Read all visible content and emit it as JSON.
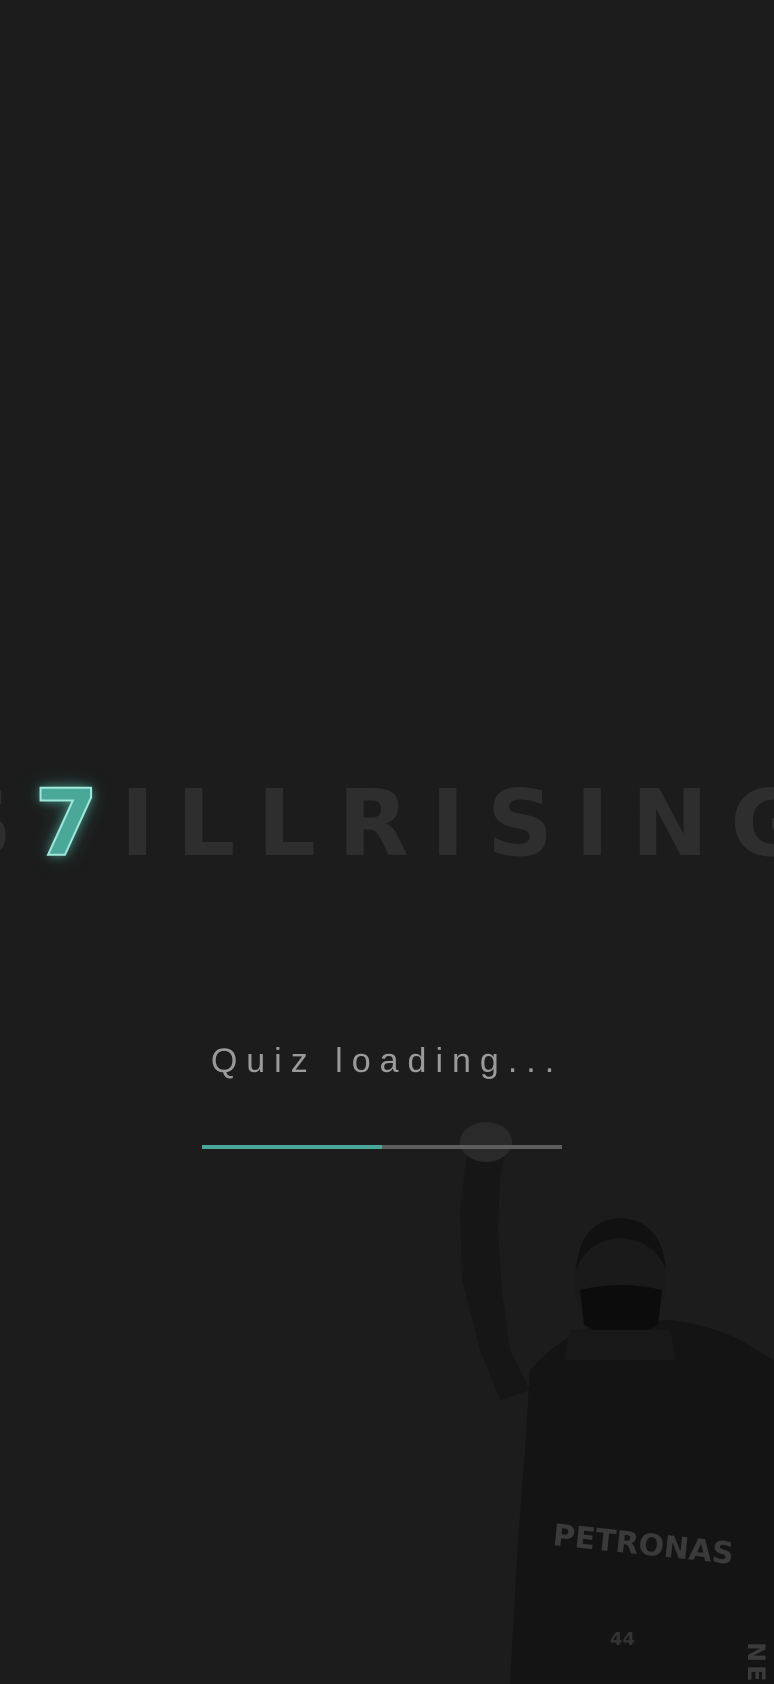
{
  "logo": {
    "prefix": "S",
    "digit": "7",
    "suffix": "ILLRISING",
    "accent_color": "#4aa898"
  },
  "loading": {
    "text": "Quiz loading...",
    "progress": 0.5,
    "fill_color": "#4aa898",
    "track_color": "#5e5e5e"
  },
  "background": {
    "color": "#1c1c1c",
    "image": "driver-raised-fist-photo",
    "suit_text": "PETRONAS",
    "number_text": "44",
    "side_text": "NE"
  }
}
